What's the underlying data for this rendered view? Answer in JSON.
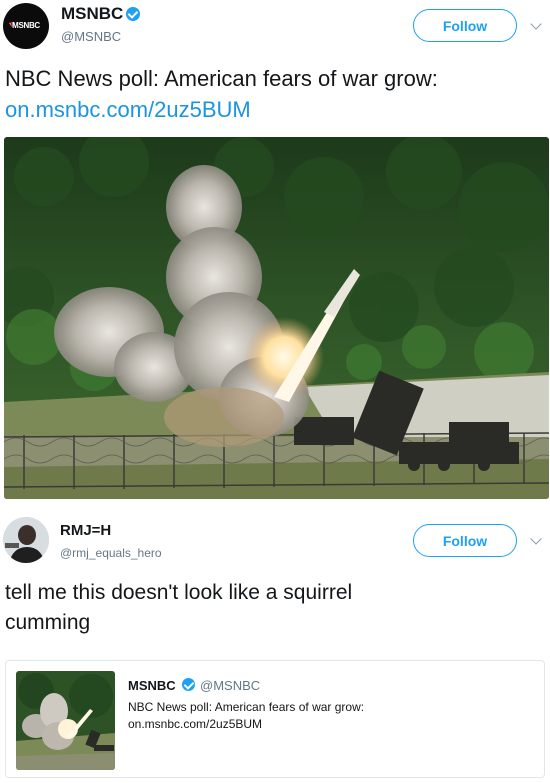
{
  "tweet1": {
    "display_name": "MSNBC",
    "handle": "@MSNBC",
    "avatar_text": "MSNBC",
    "follow_label": "Follow",
    "text": "NBC News poll: American fears of war grow:",
    "link": "on.msnbc.com/2uz5BUM",
    "media_icon": "missile-launch-photo"
  },
  "tweet2": {
    "display_name": "RMJ=H",
    "handle": "@rmj_equals_hero",
    "follow_label": "Follow",
    "text_line1": "tell me this doesn't look like a squirrel",
    "text_line2": "cumming",
    "quote": {
      "display_name": "MSNBC",
      "handle": "@MSNBC",
      "text": "NBC News poll: American fears of war grow:",
      "link": "on.msnbc.com/2uz5BUM"
    }
  },
  "colors": {
    "twitter_blue": "#1da1f2",
    "link_blue": "#1b95e0",
    "secondary_text": "#657786"
  }
}
